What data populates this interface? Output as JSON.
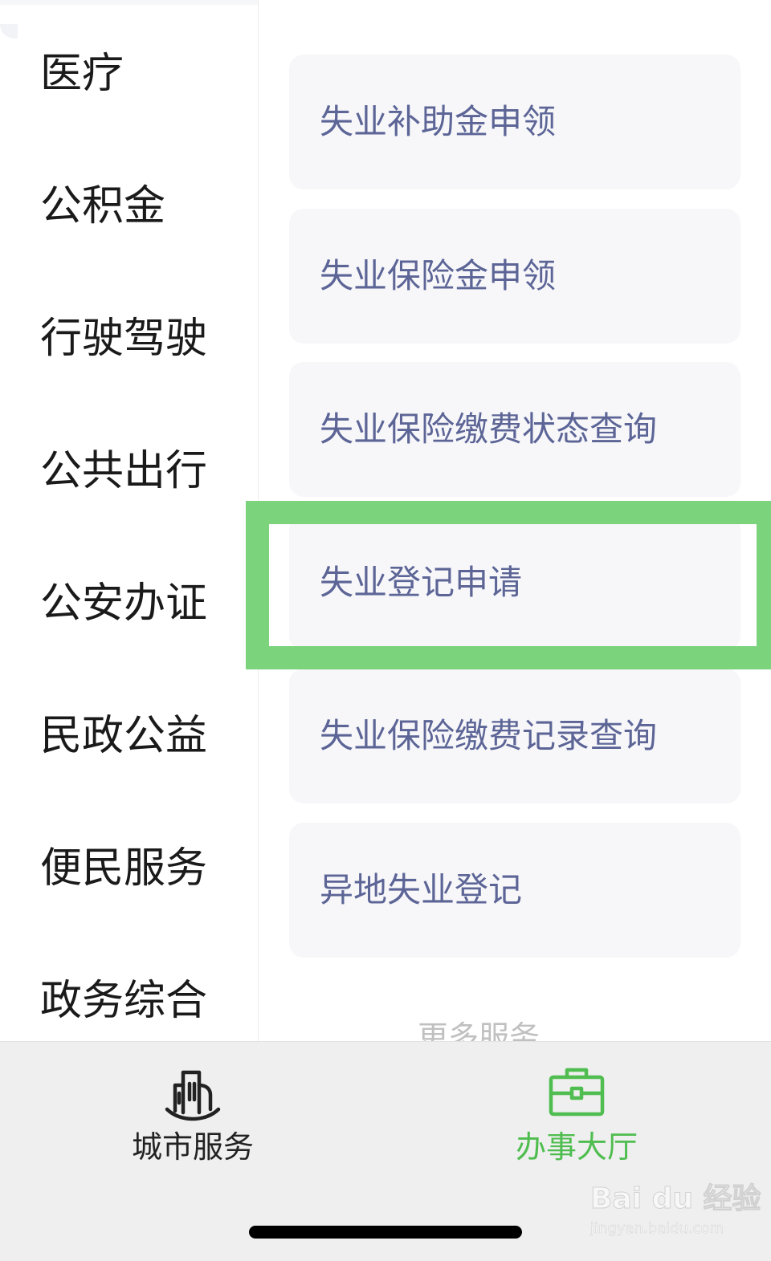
{
  "sidebar": {
    "items": [
      {
        "label": "医疗"
      },
      {
        "label": "公积金"
      },
      {
        "label": "行驶驾驶"
      },
      {
        "label": "公共出行"
      },
      {
        "label": "公安办证"
      },
      {
        "label": "民政公益"
      },
      {
        "label": "便民服务"
      },
      {
        "label": "政务综合"
      }
    ]
  },
  "services": {
    "items": [
      {
        "label": "失业补助金申领"
      },
      {
        "label": "失业保险金申领"
      },
      {
        "label": "失业保险缴费状态查询"
      },
      {
        "label": "失业登记申请"
      },
      {
        "label": "失业保险缴费记录查询"
      },
      {
        "label": "异地失业登记"
      }
    ],
    "more_label": "更多服务"
  },
  "tabbar": {
    "tabs": [
      {
        "label": "城市服务",
        "icon": "city-buildings-icon",
        "active": false
      },
      {
        "label": "办事大厅",
        "icon": "briefcase-icon",
        "active": true
      }
    ]
  },
  "watermark": {
    "main": "Bai du 经验",
    "sub": "jingyan.baidu.com"
  },
  "colors": {
    "highlight": "#7bd37b",
    "card_text": "#5c6596",
    "active_tab": "#4fbd4f",
    "inactive_tab": "#222222"
  }
}
